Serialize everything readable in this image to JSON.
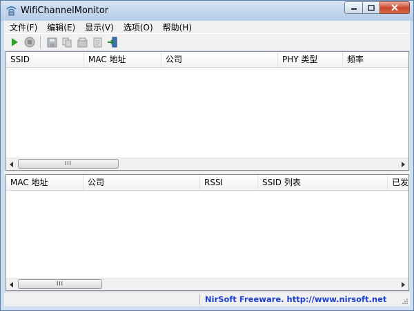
{
  "window": {
    "title": "WifiChannelMonitor"
  },
  "menu": [
    {
      "label": "文件(F)"
    },
    {
      "label": "编辑(E)"
    },
    {
      "label": "显示(V)"
    },
    {
      "label": "选项(O)"
    },
    {
      "label": "帮助(H)"
    }
  ],
  "toolbar": {
    "icons": [
      "play-icon",
      "stop-icon",
      "save-icon",
      "copy-icon",
      "properties-icon",
      "html-report-icon",
      "exit-icon"
    ]
  },
  "top_table": {
    "columns": [
      {
        "label": "SSID"
      },
      {
        "label": "MAC 地址"
      },
      {
        "label": "公司"
      },
      {
        "label": "PHY 类型"
      },
      {
        "label": "频率"
      }
    ]
  },
  "bottom_table": {
    "columns": [
      {
        "label": "MAC 地址"
      },
      {
        "label": "公司"
      },
      {
        "label": "RSSI"
      },
      {
        "label": "SSID 列表"
      },
      {
        "label": "已发送"
      }
    ]
  },
  "scroll": {
    "grip_symbol": "III"
  },
  "status": {
    "link_text": "NirSoft Freeware.  http://www.nirsoft.net"
  },
  "colors": {
    "play": "#2aa52a",
    "link": "#1c3fd0",
    "close_button": "#c8462a"
  }
}
